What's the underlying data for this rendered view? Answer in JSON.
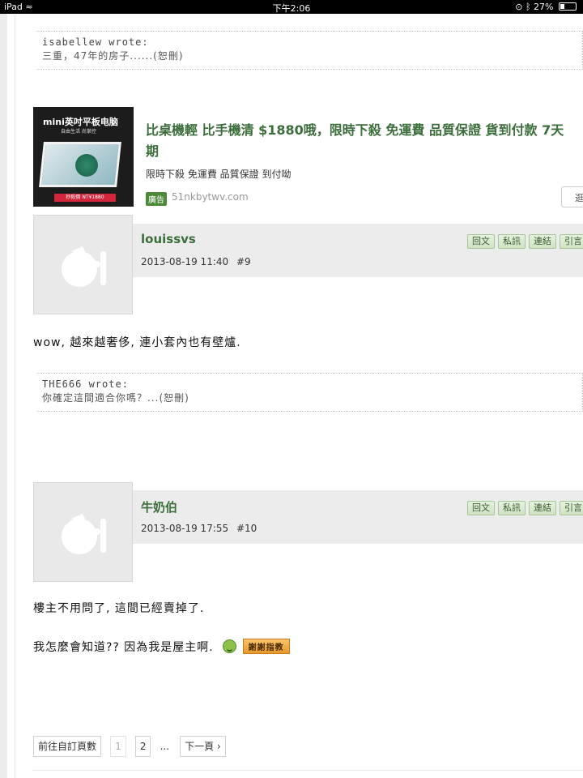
{
  "status_bar": {
    "device": "iPad",
    "time": "下午2:06",
    "battery": "27%",
    "battery_level": 0.27
  },
  "quotes": [
    {
      "author": "isabellew wrote:",
      "text": "三重，47年的房子......(恕刪)"
    },
    {
      "author": "THE666 wrote:",
      "text": "你確定這間適合你嗎？...(恕刪)"
    }
  ],
  "ad": {
    "image_headline": "mini英吋平板电脑",
    "image_sub": "自由生活 尚掌控",
    "image_price": "秒殺價 NT¥1880",
    "title_line1": "比桌機輕 比手機清 $1880哦，限時下殺 免運費 品質保證 貨到付款 7天",
    "title_line2": "期",
    "desc": "限時下殺 免運費 品質保證 到付呦",
    "badge": "廣告",
    "domain": "51nkbytwv.com",
    "button": "逛"
  },
  "posts": [
    {
      "author": "louissvs",
      "date": "2013-08-19 11:40",
      "floor": "#9",
      "text_lines": [
        "wow, 越來越奢侈, 連小套內也有壁爐."
      ]
    },
    {
      "author": "牛奶伯",
      "date": "2013-08-19 17:55",
      "floor": "#10",
      "text_lines": [
        "樓主不用問了, 這間已經賣掉了.",
        "我怎麼會知道?? 因為我是屋主啊."
      ],
      "sticker": "謝謝指教"
    }
  ],
  "post_actions": [
    "回文",
    "私訊",
    "連結",
    "引言"
  ],
  "pagination": {
    "goto": "前往自訂頁數",
    "pages": [
      "1",
      "2"
    ],
    "ellipsis": "...",
    "next": "下一頁 ›"
  }
}
